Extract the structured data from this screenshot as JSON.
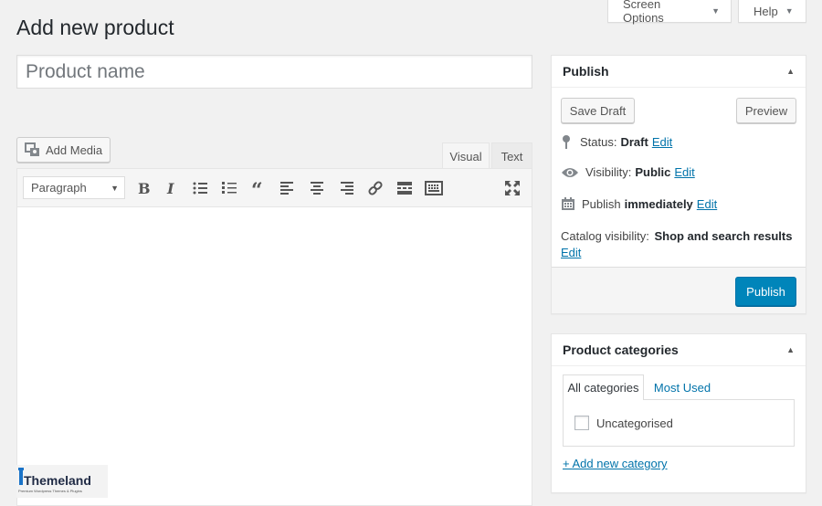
{
  "header": {
    "title": "Add new product",
    "screen_options": "Screen Options",
    "help": "Help"
  },
  "editor": {
    "title_placeholder": "Product name",
    "add_media": "Add Media",
    "tabs": {
      "visual": "Visual",
      "text": "Text"
    },
    "format_select": "Paragraph",
    "toolbar_icons": [
      "bold-icon",
      "italic-icon",
      "bullet-list-icon",
      "numbered-list-icon",
      "blockquote-icon",
      "align-left-icon",
      "align-center-icon",
      "align-right-icon",
      "link-icon",
      "read-more-icon",
      "toolbar-toggle-icon",
      "fullscreen-icon"
    ]
  },
  "publish": {
    "title": "Publish",
    "save_draft": "Save Draft",
    "preview": "Preview",
    "status_label": "Status:",
    "status_value": "Draft",
    "visibility_label": "Visibility:",
    "visibility_value": "Public",
    "publish_label": "Publish",
    "publish_value": "immediately",
    "catalog_label": "Catalog visibility:",
    "catalog_value": "Shop and search results",
    "edit": "Edit",
    "publish_button": "Publish"
  },
  "categories": {
    "title": "Product categories",
    "tab_all": "All categories",
    "tab_most_used": "Most Used",
    "items": [
      {
        "label": "Uncategorised",
        "checked": false
      }
    ],
    "add_new": "+ Add new category"
  },
  "colors": {
    "accent": "#0085ba",
    "link": "#0073aa",
    "background": "#f1f1f1"
  }
}
